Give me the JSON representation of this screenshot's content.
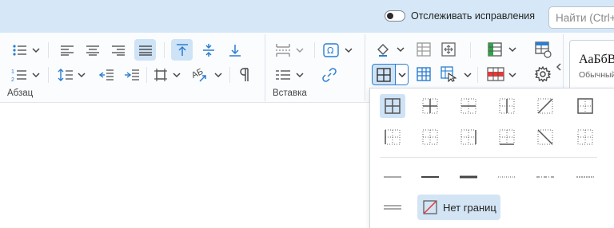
{
  "topbar": {
    "track_changes_label": "Отслеживать исправления",
    "track_changes_on": false,
    "search_placeholder": "Найти (Ctrl+F)"
  },
  "ribbon": {
    "groups": {
      "paragraph_label": "Абзац",
      "insert_label": "Вставка"
    },
    "styles": {
      "preview_text": "АаБбВвГг",
      "style_name": "Обычный"
    }
  },
  "borders_dropdown": {
    "presets": [
      "all-borders",
      "inner-borders",
      "inner-horizontal-borders",
      "inner-vertical-borders",
      "diagonal-up-border",
      "outer-borders",
      "no-outer-dotted",
      "top-bottom-dotted",
      "top-border",
      "bottom-border",
      "diagonal-down-border",
      "left-right-dotted"
    ],
    "line_styles": [
      "thin",
      "medium",
      "thick",
      "dotted",
      "dash-dot",
      "dashed",
      "double"
    ],
    "no_border_label": "Нет границ"
  },
  "colors": {
    "accent": "#2a7dd1",
    "active_bg": "#cfe3f6",
    "ribbon_top_bg": "#d6e8f8"
  }
}
